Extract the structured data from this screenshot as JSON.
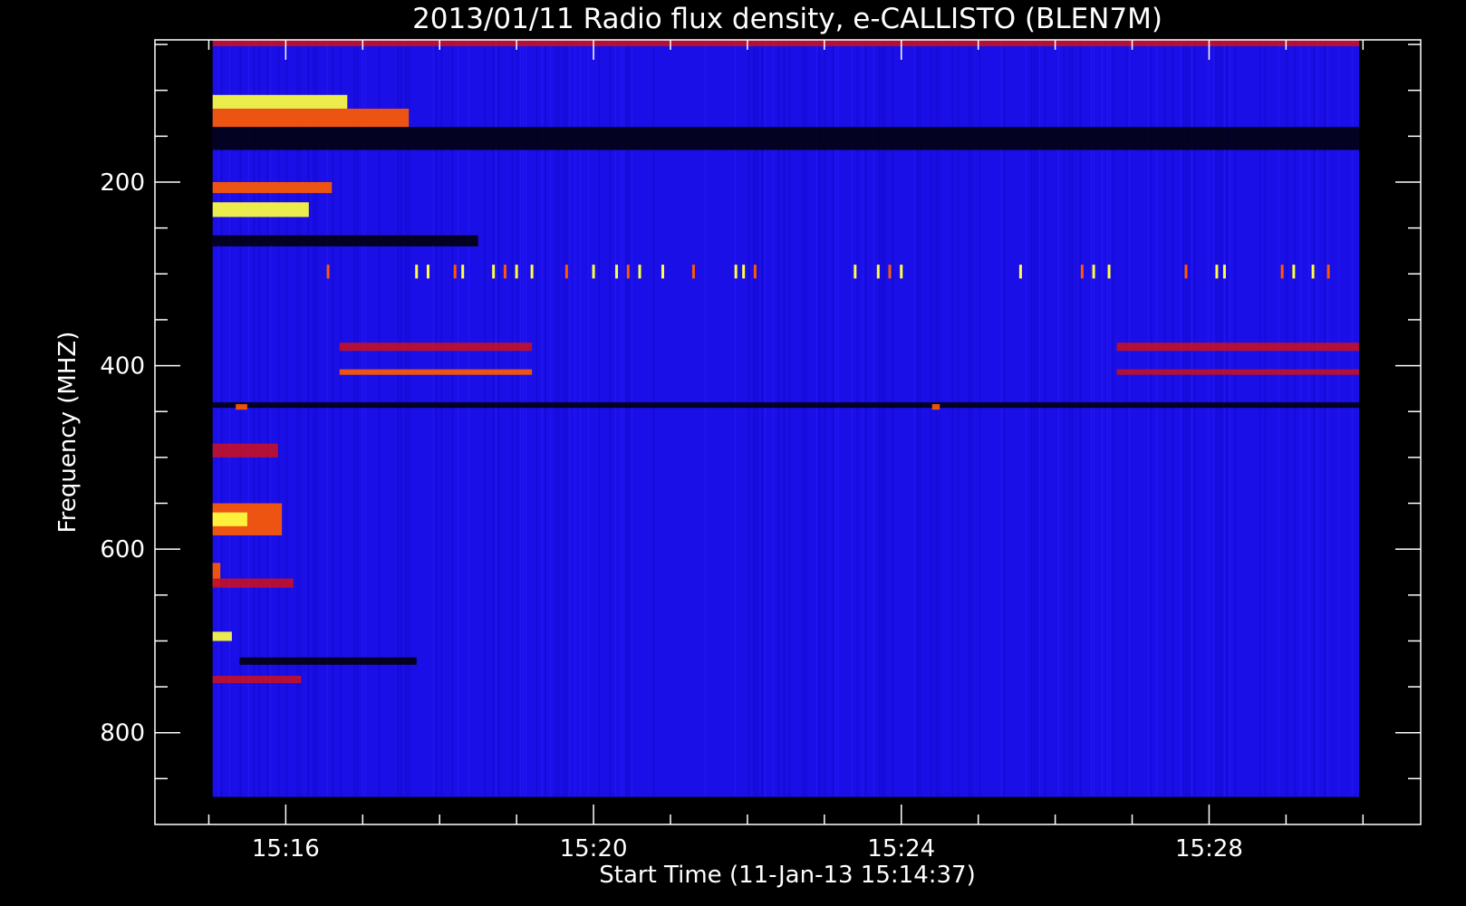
{
  "chart_data": {
    "type": "heatmap",
    "title": "2013/01/11  Radio flux density, e-CALLISTO (BLEN7M)",
    "xlabel": "Start Time (11-Jan-13 15:14:37)",
    "ylabel": "Frequency (MHZ)",
    "x_ticks": [
      "15:16",
      "15:20",
      "15:24",
      "15:28"
    ],
    "x_tick_minutes": [
      16,
      20,
      24,
      28
    ],
    "x_minor_minutes": [
      15,
      16,
      17,
      18,
      19,
      20,
      21,
      22,
      23,
      24,
      25,
      26,
      27,
      28,
      29,
      30
    ],
    "xlim_minutes": [
      14.3,
      30.75
    ],
    "x_data_range_minutes": [
      15.05,
      29.95
    ],
    "y_ticks": [
      "200",
      "400",
      "600",
      "800"
    ],
    "y_tick_values": [
      200,
      400,
      600,
      800
    ],
    "y_minor_values": [
      50,
      100,
      150,
      200,
      250,
      300,
      350,
      400,
      450,
      500,
      550,
      600,
      650,
      700,
      750,
      800,
      850
    ],
    "ylim": [
      900,
      45
    ],
    "y_data_range": [
      870,
      45
    ],
    "y_inverted": true,
    "colormap": {
      "background": "#1a0fe6",
      "low": "#000000",
      "mid": "#c0102a",
      "high": "#ff5a00",
      "peak": "#ffff40"
    },
    "features": [
      {
        "f1": 45,
        "f2": 52,
        "t1": 15.05,
        "t2": 29.95,
        "level": "mid"
      },
      {
        "f1": 105,
        "f2": 120,
        "t1": 15.05,
        "t2": 16.8,
        "level": "peak"
      },
      {
        "f1": 120,
        "f2": 140,
        "t1": 15.05,
        "t2": 17.6,
        "level": "high"
      },
      {
        "f1": 140,
        "f2": 165,
        "t1": 15.05,
        "t2": 29.95,
        "level": "low"
      },
      {
        "f1": 200,
        "f2": 212,
        "t1": 15.05,
        "t2": 16.6,
        "level": "high"
      },
      {
        "f1": 222,
        "f2": 238,
        "t1": 15.05,
        "t2": 16.3,
        "level": "peak"
      },
      {
        "f1": 258,
        "f2": 270,
        "t1": 15.05,
        "t2": 18.5,
        "level": "low"
      },
      {
        "f1": 375,
        "f2": 384,
        "t1": 16.7,
        "t2": 19.2,
        "level": "mid"
      },
      {
        "f1": 404,
        "f2": 410,
        "t1": 16.7,
        "t2": 19.2,
        "level": "high"
      },
      {
        "f1": 375,
        "f2": 384,
        "t1": 26.8,
        "t2": 29.95,
        "level": "mid"
      },
      {
        "f1": 404,
        "f2": 410,
        "t1": 26.8,
        "t2": 29.95,
        "level": "mid"
      },
      {
        "f1": 440,
        "f2": 446,
        "t1": 15.05,
        "t2": 29.95,
        "level": "low"
      },
      {
        "f1": 442,
        "f2": 448,
        "t1": 15.35,
        "t2": 15.5,
        "level": "high"
      },
      {
        "f1": 442,
        "f2": 448,
        "t1": 24.4,
        "t2": 24.5,
        "level": "high"
      },
      {
        "f1": 485,
        "f2": 500,
        "t1": 15.05,
        "t2": 15.9,
        "level": "mid"
      },
      {
        "f1": 550,
        "f2": 585,
        "t1": 15.05,
        "t2": 15.95,
        "level": "high"
      },
      {
        "f1": 560,
        "f2": 575,
        "t1": 15.05,
        "t2": 15.5,
        "level": "peak"
      },
      {
        "f1": 615,
        "f2": 640,
        "t1": 15.05,
        "t2": 15.15,
        "level": "high"
      },
      {
        "f1": 632,
        "f2": 642,
        "t1": 15.05,
        "t2": 16.1,
        "level": "mid"
      },
      {
        "f1": 690,
        "f2": 700,
        "t1": 15.05,
        "t2": 15.3,
        "level": "peak"
      },
      {
        "f1": 718,
        "f2": 726,
        "t1": 15.4,
        "t2": 17.7,
        "level": "low"
      },
      {
        "f1": 738,
        "f2": 746,
        "t1": 15.05,
        "t2": 16.2,
        "level": "mid"
      }
    ],
    "spikes_band": [
      290,
      305
    ],
    "spike_minutes": [
      16.55,
      17.7,
      17.85,
      18.2,
      18.3,
      18.7,
      18.85,
      19.0,
      19.2,
      19.65,
      20.0,
      20.3,
      20.45,
      20.6,
      20.9,
      21.3,
      21.85,
      21.95,
      22.1,
      23.4,
      23.7,
      23.85,
      24.0,
      25.55,
      26.35,
      26.5,
      26.7,
      27.7,
      28.1,
      28.2,
      28.95,
      29.1,
      29.35,
      29.55
    ]
  }
}
